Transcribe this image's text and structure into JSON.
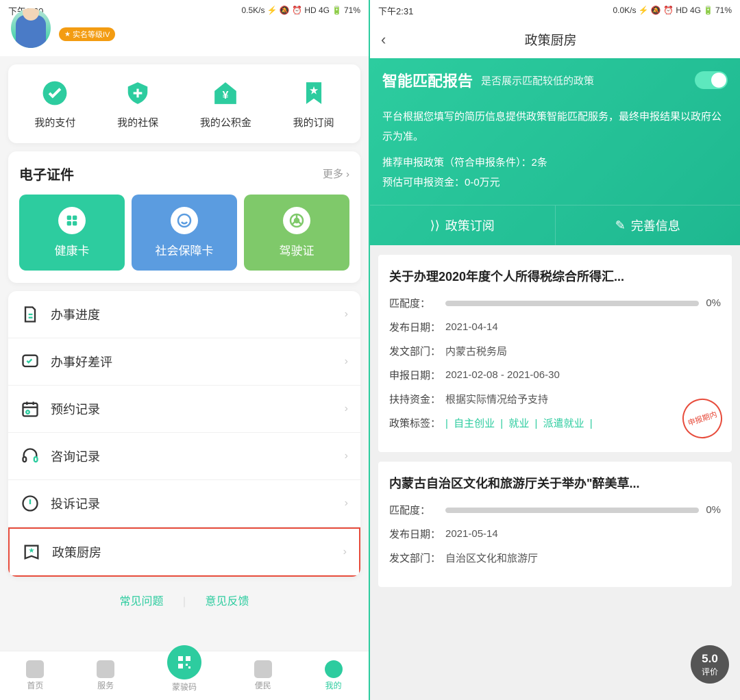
{
  "left": {
    "status": {
      "time": "下午2:30",
      "speed": "0.5K/s",
      "icons": "⚡ 🔕 ⏰ HD 4G",
      "battery": "71%"
    },
    "badge": "实名等级IV",
    "quick": [
      {
        "label": "我的支付"
      },
      {
        "label": "我的社保"
      },
      {
        "label": "我的公积金"
      },
      {
        "label": "我的订阅"
      }
    ],
    "ecert": {
      "title": "电子证件",
      "more": "更多",
      "cards": [
        {
          "label": "健康卡"
        },
        {
          "label": "社会保障卡"
        },
        {
          "label": "驾驶证"
        }
      ]
    },
    "list": [
      {
        "label": "办事进度"
      },
      {
        "label": "办事好差评"
      },
      {
        "label": "预约记录"
      },
      {
        "label": "咨询记录"
      },
      {
        "label": "投诉记录"
      },
      {
        "label": "政策厨房"
      }
    ],
    "footer": {
      "faq": "常见问题",
      "feedback": "意见反馈"
    },
    "tabs": [
      {
        "label": "首页"
      },
      {
        "label": "服务"
      },
      {
        "label": "蒙骏码"
      },
      {
        "label": "便民"
      },
      {
        "label": "我的"
      }
    ]
  },
  "right": {
    "status": {
      "time": "下午2:31",
      "speed": "0.0K/s",
      "icons": "⚡ 🔕 ⏰ HD 4G",
      "battery": "71%"
    },
    "nav_title": "政策厨房",
    "report": {
      "title": "智能匹配报告",
      "sub": "是否展示匹配较低的政策",
      "desc": "平台根据您填写的简历信息提供政策智能匹配服务，最终申报结果以政府公示为准。",
      "line1": "推荐申报政策（符合申报条件）：2条",
      "line2": "预估可申报资金：0-0万元",
      "btn1": "政策订阅",
      "btn2": "完善信息"
    },
    "policy1": {
      "title": "关于办理2020年度个人所得税综合所得汇...",
      "match_label": "匹配度：",
      "match_pct": "0%",
      "pub_label": "发布日期：",
      "pub_val": "2021-04-14",
      "dept_label": "发文部门：",
      "dept_val": "内蒙古税务局",
      "apply_label": "申报日期：",
      "apply_val": "2021-02-08 - 2021-06-30",
      "fund_label": "扶持资金：",
      "fund_val": "根据实际情况给予支持",
      "tag_label": "政策标签：",
      "tags": [
        "自主创业",
        "就业",
        "派遣就业"
      ],
      "stamp": "申报期内"
    },
    "policy2": {
      "title": "内蒙古自治区文化和旅游厅关于举办\"醉美草...",
      "match_label": "匹配度：",
      "match_pct": "0%",
      "pub_label": "发布日期：",
      "pub_val": "2021-05-14",
      "dept_label": "发文部门：",
      "dept_val": "自治区文化和旅游厅"
    },
    "rating": {
      "score": "5.0",
      "label": "评价"
    }
  }
}
